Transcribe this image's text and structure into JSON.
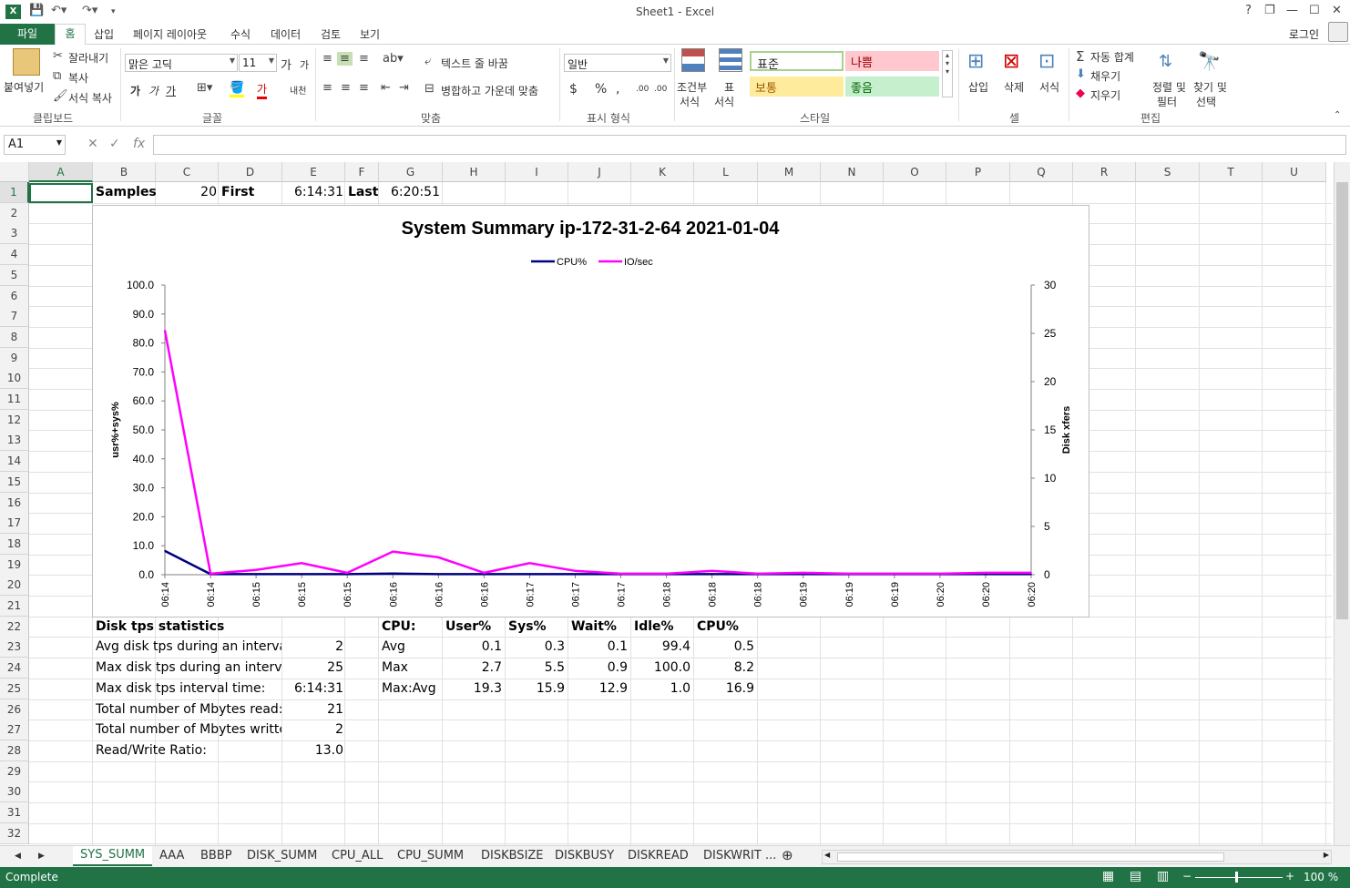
{
  "window": {
    "title": "Sheet1 - Excel"
  },
  "quick_access": {
    "save_icon": "save-icon",
    "undo_icon": "undo-icon",
    "redo_icon": "redo-icon"
  },
  "window_controls": {
    "help": "?",
    "restore": "❐",
    "minimize": "—",
    "maximize": "☐",
    "close": "✕"
  },
  "tabs": [
    "파일",
    "홈",
    "삽입",
    "페이지 레이아웃",
    "수식",
    "데이터",
    "검토",
    "보기"
  ],
  "account": {
    "login": "로그인"
  },
  "ribbon": {
    "clipboard": {
      "paste": "붙여넣기",
      "cut": "잘라내기",
      "copy": "복사",
      "format_painter": "서식 복사",
      "label": "클립보드"
    },
    "font": {
      "name": "맑은 고딕",
      "size": "11",
      "grow": "가",
      "shrink": "가",
      "bold": "가",
      "italic": "가",
      "underline": "가",
      "label": "글꼴",
      "phonetic": "내천",
      "font_color_glyph": "가"
    },
    "alignment": {
      "wrap": "텍스트 줄 바꿈",
      "merge": "병합하고 가운데 맞춤",
      "label": "맞춤"
    },
    "number": {
      "format": "일반",
      "currency": "$",
      "percent": "%",
      "comma": ",",
      "label": "표시 형식",
      "inc_dec": ".00",
      "dec_dec": ".00"
    },
    "styles": {
      "conditional": "조건부",
      "conditional2": "서식",
      "table": "표",
      "table2": "서식",
      "normal": "표준",
      "bad": "나쁨",
      "neutral": "보통",
      "good": "좋음",
      "label": "스타일"
    },
    "cells": {
      "insert": "삽입",
      "delete": "삭제",
      "format": "서식",
      "label": "셀"
    },
    "editing": {
      "autosum": "자동 합계",
      "fill": "채우기",
      "clear": "지우기",
      "sort1": "정렬 및",
      "sort2": "필터",
      "find1": "찾기 및",
      "find2": "선택",
      "label": "편집"
    }
  },
  "formula_bar": {
    "name_box": "A1",
    "fx": "fx",
    "formula": ""
  },
  "columns": [
    "A",
    "B",
    "C",
    "D",
    "E",
    "F",
    "G",
    "H",
    "I",
    "J",
    "K",
    "L",
    "M",
    "N",
    "O",
    "P",
    "Q",
    "R",
    "S",
    "T",
    "U"
  ],
  "rows": [
    "1",
    "2",
    "3",
    "4",
    "5",
    "6",
    "7",
    "8",
    "9",
    "10",
    "11",
    "12",
    "13",
    "14",
    "15",
    "16",
    "17",
    "18",
    "19",
    "20",
    "21",
    "22",
    "23",
    "24",
    "25",
    "26",
    "27",
    "28",
    "29",
    "30",
    "31",
    "32"
  ],
  "cells": {
    "row1": {
      "samples_label": "Samples",
      "samples_value": "20",
      "first_label": "First",
      "first_value": "6:14:31",
      "last_label": "Last",
      "last_value": "6:20:51"
    },
    "disk_stats": {
      "header": "Disk tps statistics",
      "rows": [
        {
          "label": "Avg disk tps during an interval",
          "value": "2"
        },
        {
          "label": "Max disk tps during an interva",
          "value": "25"
        },
        {
          "label": "Max disk tps interval time:",
          "value": "6:14:31"
        },
        {
          "label": "Total number of Mbytes read:",
          "value": "21"
        },
        {
          "label": "Total number of Mbytes writte",
          "value": "2"
        },
        {
          "label": "Read/Write Ratio:",
          "value": "13.0"
        }
      ]
    },
    "cpu_stats": {
      "headers": [
        "CPU:",
        "User%",
        "Sys%",
        "Wait%",
        "Idle%",
        "CPU%"
      ],
      "rows": [
        [
          "Avg",
          "0.1",
          "0.3",
          "0.1",
          "99.4",
          "0.5"
        ],
        [
          "Max",
          "2.7",
          "5.5",
          "0.9",
          "100.0",
          "8.2"
        ],
        [
          "Max:Avg",
          "19.3",
          "15.9",
          "12.9",
          "1.0",
          "16.9"
        ]
      ]
    }
  },
  "chart_data": {
    "type": "line",
    "title": "System Summary ip-172-31-2-64  2021-01-04",
    "categories": [
      "06:14",
      "06:14",
      "06:15",
      "06:15",
      "06:15",
      "06:16",
      "06:16",
      "06:16",
      "06:17",
      "06:17",
      "06:17",
      "06:18",
      "06:18",
      "06:18",
      "06:19",
      "06:19",
      "06:19",
      "06:20",
      "06:20",
      "06:20"
    ],
    "series": [
      {
        "name": "CPU%",
        "color": "#000080",
        "axis": "left",
        "values": [
          8.2,
          0.2,
          0.2,
          0.2,
          0.2,
          0.4,
          0.2,
          0.2,
          0.2,
          0.2,
          0.2,
          0.2,
          0.2,
          0.2,
          0.2,
          0.2,
          0.2,
          0.2,
          0.2,
          0.2
        ]
      },
      {
        "name": "IO/sec",
        "color": "#ff00ff",
        "axis": "right",
        "values": [
          25.3,
          0.1,
          0.5,
          1.2,
          0.2,
          2.4,
          1.8,
          0.2,
          1.2,
          0.4,
          0.1,
          0.1,
          0.4,
          0.1,
          0.2,
          0.1,
          0.1,
          0.1,
          0.2,
          0.2
        ]
      }
    ],
    "ylabel": "usr%+sys%",
    "y2label": "Disk xfers",
    "ylim": [
      0,
      100
    ],
    "y2lim": [
      0,
      30
    ],
    "yticks": [
      "0.0",
      "10.0",
      "20.0",
      "30.0",
      "40.0",
      "50.0",
      "60.0",
      "70.0",
      "80.0",
      "90.0",
      "100.0"
    ],
    "y2ticks": [
      "0",
      "5",
      "10",
      "15",
      "20",
      "25",
      "30"
    ],
    "legend": "top"
  },
  "sheet_tabs": [
    "SYS_SUMM",
    "AAA",
    "BBBP",
    "DISK_SUMM",
    "CPU_ALL",
    "CPU_SUMM",
    "DISKBSIZE",
    "DISKBUSY",
    "DISKREAD",
    "DISKWRIT ..."
  ],
  "status": {
    "text": "Complete",
    "zoom": "100 %"
  }
}
